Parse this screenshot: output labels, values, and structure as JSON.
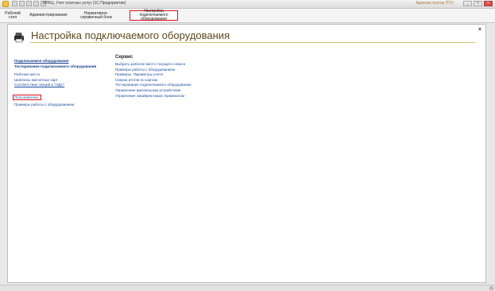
{
  "window": {
    "title": "ИРКЦ: Учет платных услуг  (1С:Предприятие)",
    "user_info": "Администратор ПТО",
    "controls": {
      "minimize": "_",
      "maximize": "□",
      "close": "×"
    }
  },
  "sections": [
    {
      "label": "Рабочий стол"
    },
    {
      "label": "Администрирование"
    },
    {
      "label": "Нормативно-справочный блок"
    },
    {
      "label": "Настройка подключаемого оборудования"
    }
  ],
  "page": {
    "title": "Настройка подключаемого оборудования",
    "close_label": "×",
    "icon": "printer-icon"
  },
  "left_panel": {
    "links_top": [
      {
        "label": "Подключаемое оборудование"
      },
      {
        "label": "Тестирование подключаемого оборудования"
      }
    ],
    "links": [
      {
        "label": "Рабочие места"
      },
      {
        "label": "Шаблоны магнитных карт"
      },
      {
        "label": "Соответствие секций и \"НДС\""
      },
      {
        "label": "Пользователи"
      },
      {
        "label": "Примеры работы с оборудованием"
      }
    ]
  },
  "right_panel": {
    "heading": "Сервис",
    "links": [
      {
        "label": "Выбрать рабочее место текущего сеанса"
      },
      {
        "label": "Примеры работы с оборудованием"
      },
      {
        "label": "Примеры. Параметры учета"
      },
      {
        "label": "Сверка итогов по картам"
      },
      {
        "label": "Тестирование подключаемого оборудования"
      },
      {
        "label": "Управление фискальным устройством"
      },
      {
        "label": "Управление эквайринговым терминалом"
      }
    ]
  },
  "colors": {
    "highlight": "#e3101a",
    "link": "#1f4da0",
    "title": "#5a4a1e"
  }
}
